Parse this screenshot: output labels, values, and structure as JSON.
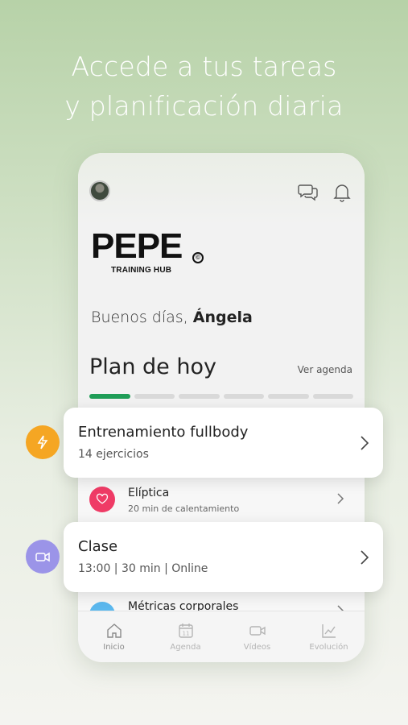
{
  "headline": {
    "line1": "Accede a tus tareas",
    "line2": "y planificación diaria"
  },
  "app": {
    "logo": {
      "text": "PEPE",
      "reg": "©",
      "subtitle": "TRAINING HUB"
    },
    "greeting": {
      "prefix": "Buenos días,",
      "name": "Ángela"
    },
    "plan": {
      "title": "Plan de hoy",
      "link": "Ver agenda",
      "progress": {
        "done": 1,
        "total": 6
      }
    },
    "list": [
      {
        "title": "Elíptica",
        "subtitle": "20 min de calentamiento",
        "icon": "heart-icon",
        "color": "#ef3b66"
      },
      {
        "title": "Métricas corporales",
        "subtitle": "",
        "icon": "metrics-icon",
        "color": "#5bb8ee"
      }
    ],
    "tabs": [
      {
        "label": "Inicio",
        "icon": "home-icon",
        "active": true
      },
      {
        "label": "Agenda",
        "icon": "calendar-icon",
        "active": false
      },
      {
        "label": "Vídeos",
        "icon": "video-icon",
        "active": false
      },
      {
        "label": "Evolución",
        "icon": "chart-icon",
        "active": false
      }
    ]
  },
  "cards": [
    {
      "title": "Entrenamiento fullbody",
      "subtitle": "14 ejercicios",
      "icon": "lightning-icon",
      "color": "#f5a623"
    },
    {
      "title": "Clase",
      "subtitle": "13:00 | 30 min | Online",
      "icon": "video-icon",
      "color": "#9b94e8"
    }
  ],
  "colors": {
    "accent_green": "#1f9d57",
    "background_top": "#b7d2a8"
  }
}
